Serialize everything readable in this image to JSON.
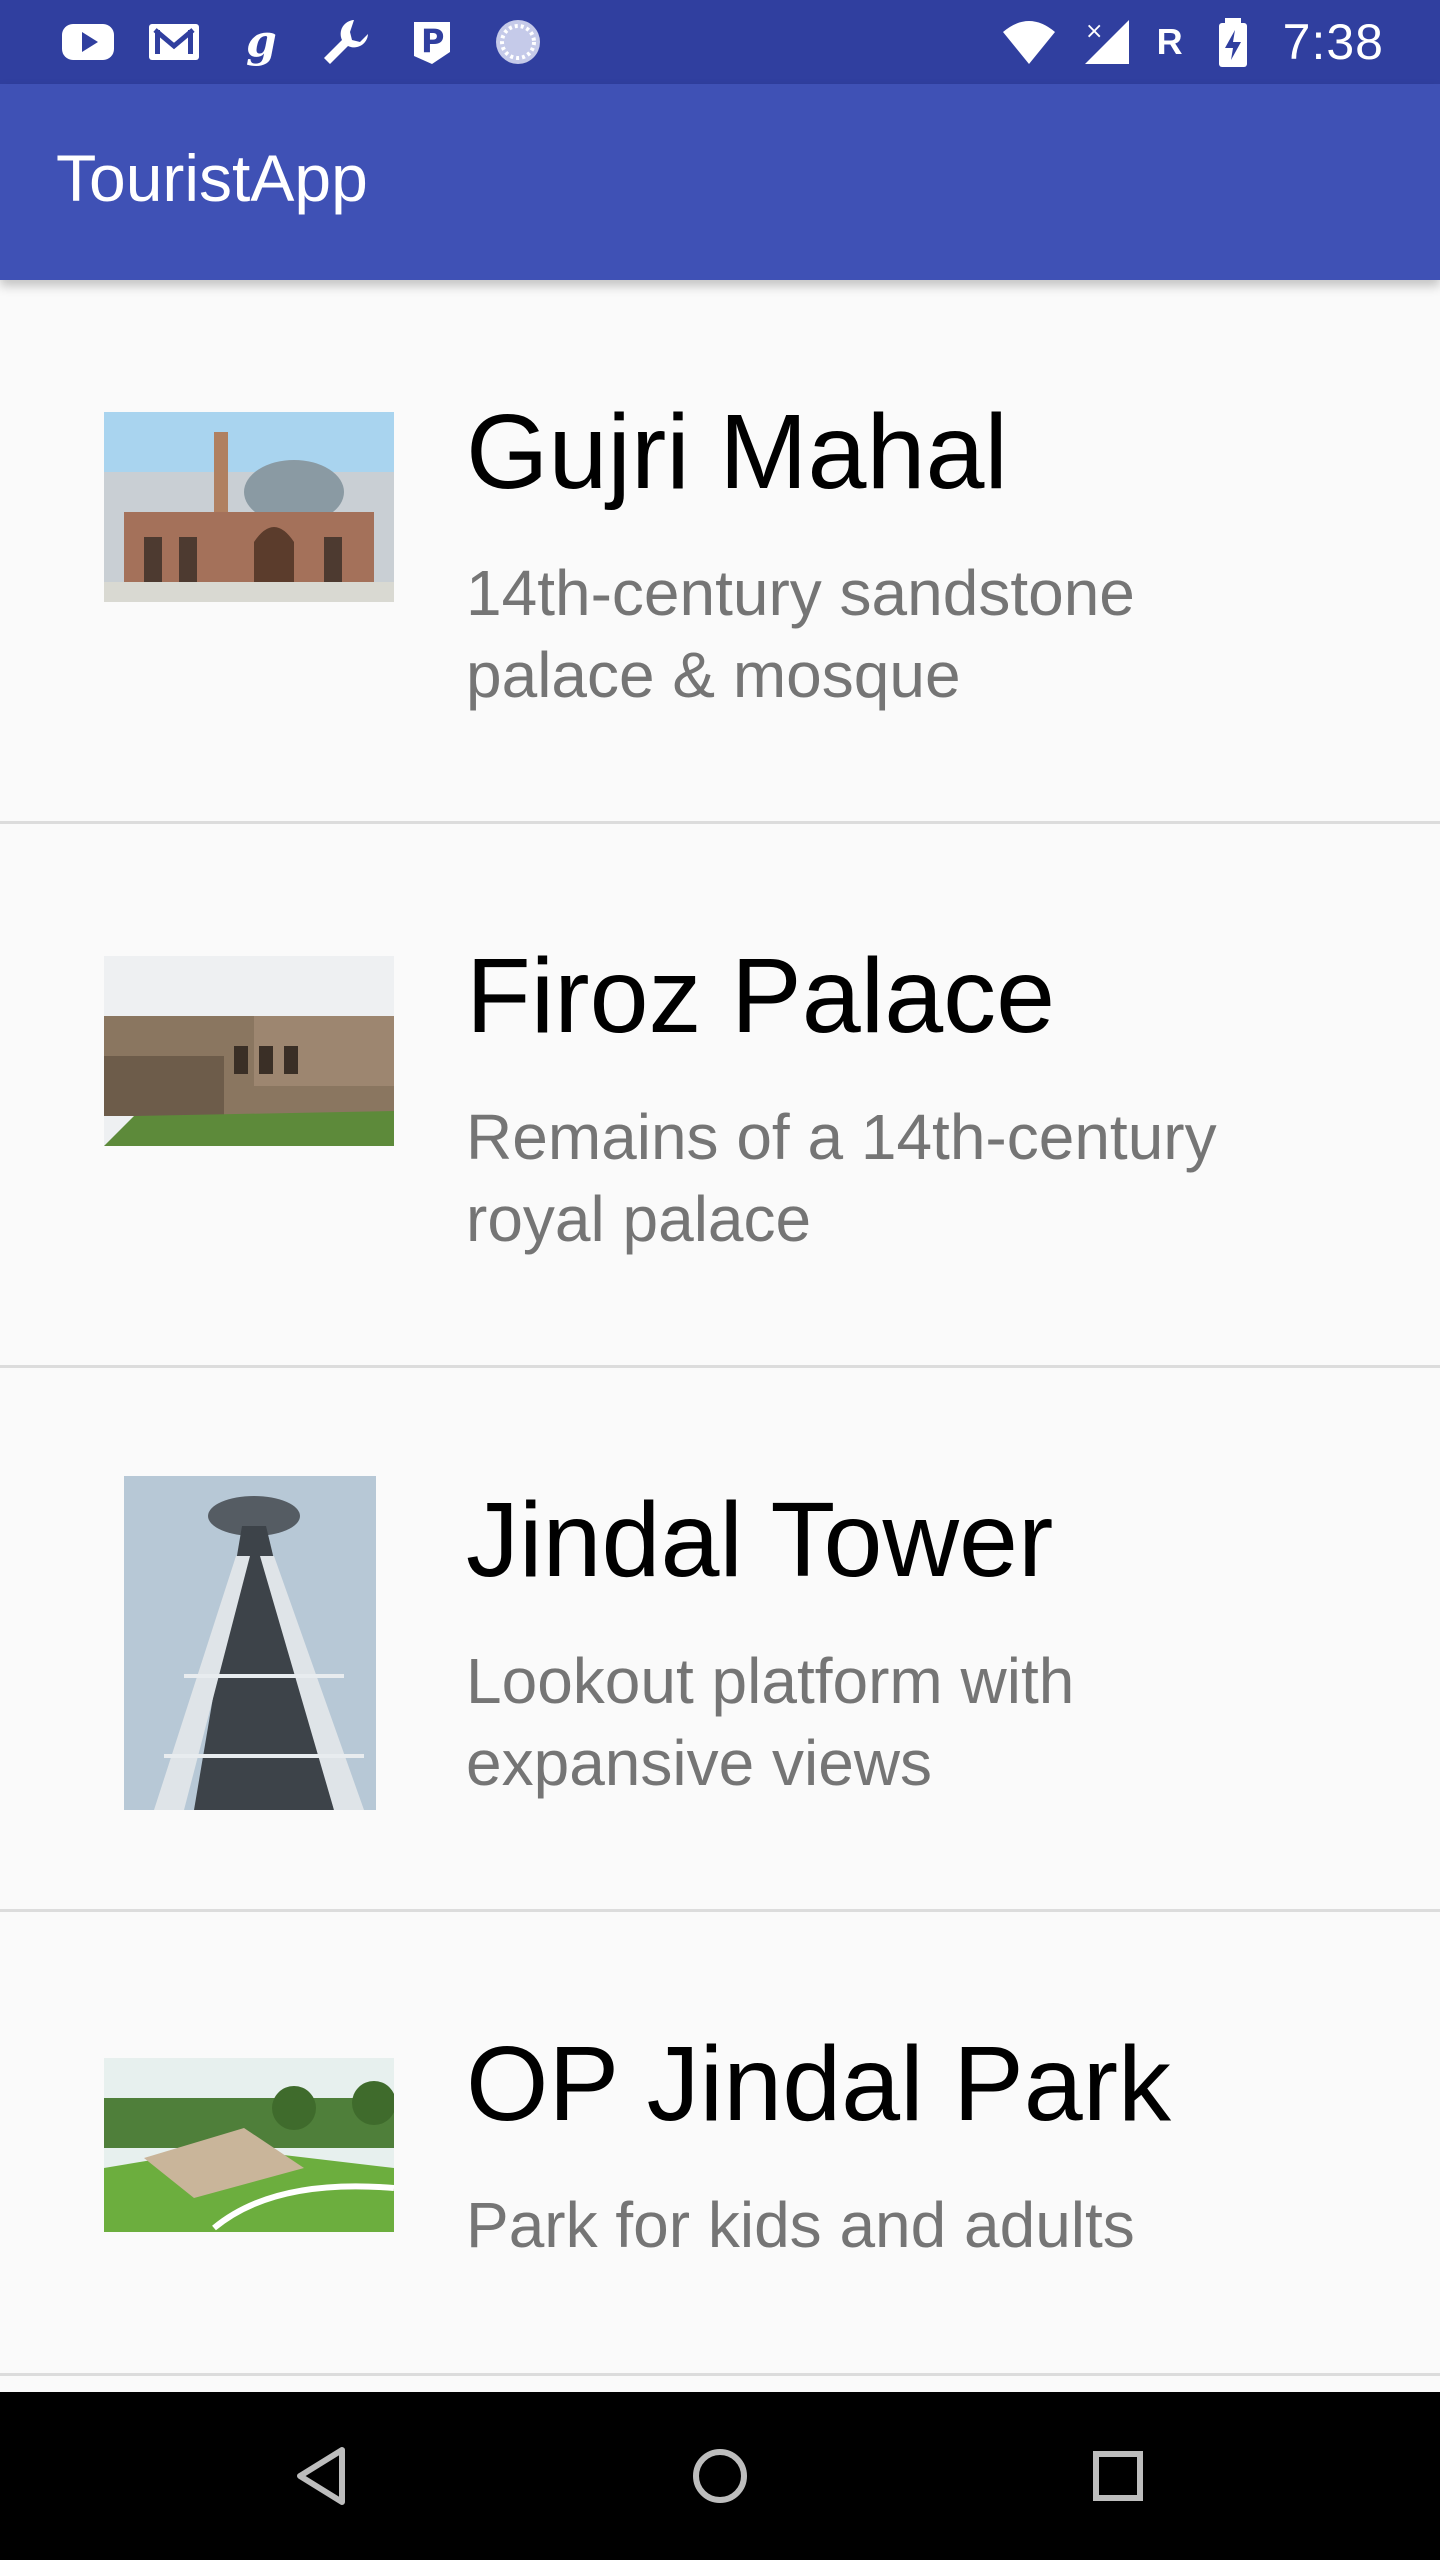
{
  "status_bar": {
    "time": "7:38",
    "carrier_letter": "R",
    "left_icons": [
      "youtube-icon",
      "gmail-icon",
      "g-icon",
      "wrench-icon",
      "p-icon",
      "loading-icon"
    ],
    "right_icons": [
      "wifi-icon",
      "signal-icon",
      "battery-icon"
    ]
  },
  "toolbar": {
    "title": "TouristApp"
  },
  "places": [
    {
      "name": "Gujri Mahal",
      "description": "14th-century sandstone palace & mosque",
      "image": "gujri-mahal-image"
    },
    {
      "name": "Firoz Palace",
      "description": "Remains of a 14th-century royal palace",
      "image": "firoz-palace-image"
    },
    {
      "name": "Jindal Tower",
      "description": "Lookout platform with expansive views",
      "image": "jindal-tower-image"
    },
    {
      "name": "OP Jindal Park",
      "description": "Park for kids and adults",
      "image": "op-jindal-park-image"
    }
  ],
  "nav_bar": {
    "buttons": [
      "back-icon",
      "home-icon",
      "recents-icon"
    ]
  },
  "colors": {
    "status_bar": "#303f9f",
    "toolbar": "#3f51b5",
    "background": "#fafafa",
    "description_text": "#757575"
  }
}
